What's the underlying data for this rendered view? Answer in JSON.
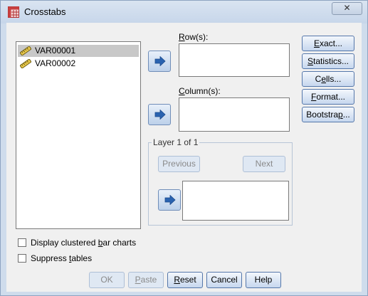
{
  "window": {
    "title": "Crosstabs",
    "close_symbol": "✕"
  },
  "variables": [
    {
      "name": "VAR00001",
      "icon": "scale-ruler-icon",
      "selected": true
    },
    {
      "name": "VAR00002",
      "icon": "scale-ruler-icon",
      "selected": false
    }
  ],
  "rows": {
    "label_underlined": "R",
    "label_rest": "ow(s):"
  },
  "columns": {
    "label_underlined": "C",
    "label_rest": "olumn(s):"
  },
  "layer": {
    "legend": "Layer 1 of 1",
    "previous": "Previous",
    "previous_underlined": "v",
    "next": "Next",
    "next_underlined": "N"
  },
  "side_buttons": [
    {
      "name": "exact-button",
      "pre": "",
      "u": "E",
      "post": "xact..."
    },
    {
      "name": "statistics-button",
      "pre": "",
      "u": "S",
      "post": "tatistics..."
    },
    {
      "name": "cells-button",
      "pre": "C",
      "u": "e",
      "post": "lls..."
    },
    {
      "name": "format-button",
      "pre": "",
      "u": "F",
      "post": "ormat..."
    },
    {
      "name": "bootstrap-button",
      "pre": "Bootstra",
      "u": "p",
      "post": "..."
    }
  ],
  "options": {
    "clustered": {
      "pre": "Display clustered ",
      "u": "b",
      "post": "ar charts",
      "checked": false
    },
    "suppress": {
      "pre": "Suppress ",
      "u": "t",
      "post": "ables",
      "checked": false
    }
  },
  "footer": {
    "ok": "OK",
    "paste": {
      "pre": "",
      "u": "P",
      "post": "aste"
    },
    "reset": {
      "pre": "",
      "u": "R",
      "post": "eset"
    },
    "cancel": "Cancel",
    "help": "Help"
  },
  "colors": {
    "button_border": "#5577aa",
    "arrow_fill": "#2a63b0",
    "selected_bg": "#c8c8c8"
  }
}
